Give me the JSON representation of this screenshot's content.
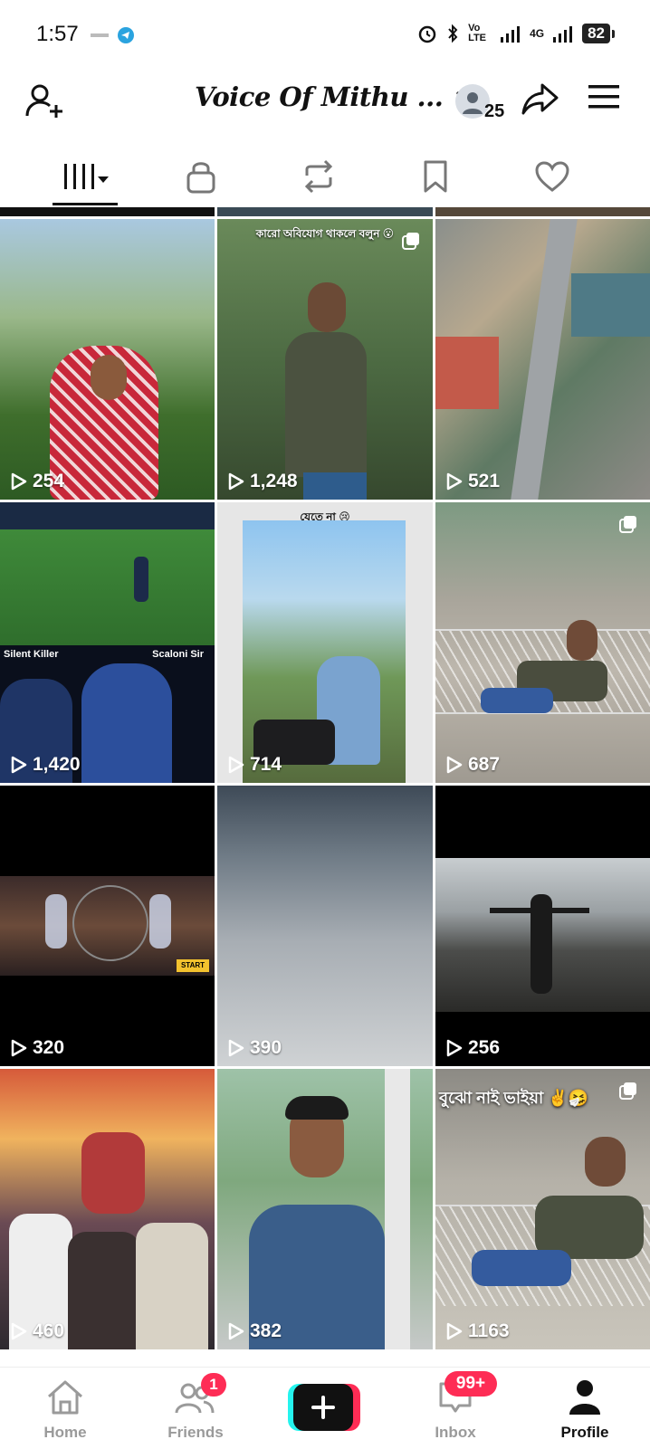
{
  "status_bar": {
    "time": "1:57",
    "signal_text_1": "Vo LTE",
    "signal_text_2": "4G",
    "battery": "82"
  },
  "header": {
    "title": "Voice Of Mithu ...",
    "follower_count": "25"
  },
  "tabs": [
    {
      "name": "videos",
      "icon": "grid-filter-icon"
    },
    {
      "name": "private",
      "icon": "lock-icon"
    },
    {
      "name": "reposts",
      "icon": "repost-icon"
    },
    {
      "name": "favorites",
      "icon": "bookmark-icon"
    },
    {
      "name": "liked",
      "icon": "heart-icon"
    }
  ],
  "videos": [
    {
      "views": "254"
    },
    {
      "views": "1,248",
      "caption": "কারো অবিযোগ থাকলে বলুন 😮"
    },
    {
      "views": "521"
    },
    {
      "views": "1,420",
      "tag_left": "Silent Killer",
      "tag_right": "Scaloni Sir"
    },
    {
      "views": "714",
      "caption": "যেতে না 😢"
    },
    {
      "views": "687"
    },
    {
      "views": "320",
      "game_button": "START"
    },
    {
      "views": "390"
    },
    {
      "views": "256"
    },
    {
      "views": "460"
    },
    {
      "views": "382"
    },
    {
      "views": "1163",
      "caption": "বুঝো নাই ভাইয়া ✌️🤧"
    }
  ],
  "bottom_nav": {
    "home": "Home",
    "friends": "Friends",
    "friends_badge": "1",
    "inbox": "Inbox",
    "inbox_badge": "99+",
    "profile": "Profile"
  }
}
